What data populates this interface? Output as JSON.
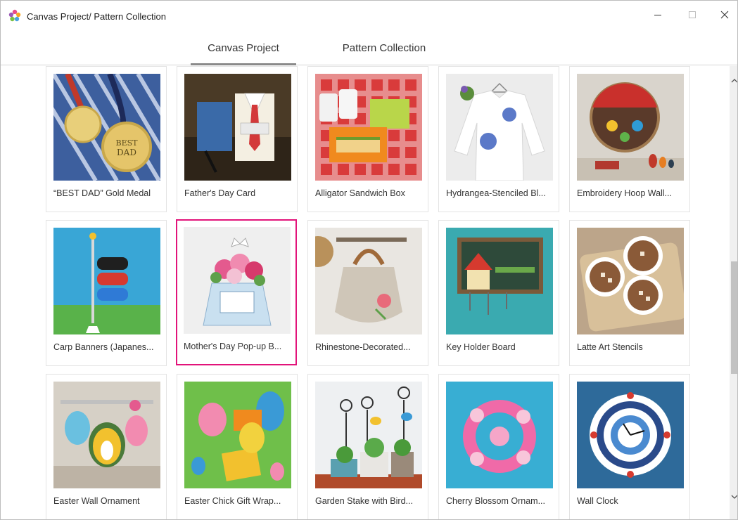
{
  "window": {
    "title": "Canvas Project/ Pattern Collection",
    "icon": "app-flower-icon",
    "controls": [
      "minimize-icon",
      "maximize-icon",
      "close-icon"
    ]
  },
  "tabs": [
    {
      "label": "Canvas Project",
      "active": true
    },
    {
      "label": "Pattern Collection",
      "active": false
    }
  ],
  "accent_color": "#e2137a",
  "projects": [
    {
      "title": "“BEST DAD” Gold Medal",
      "selected": false
    },
    {
      "title": "Father's Day Card",
      "selected": false
    },
    {
      "title": "Alligator Sandwich Box",
      "selected": false
    },
    {
      "title": "Hydrangea-Stenciled Bl...",
      "selected": false
    },
    {
      "title": "Embroidery Hoop Wall...",
      "selected": false
    },
    {
      "title": "Carp Banners (Japanes...",
      "selected": false
    },
    {
      "title": "Mother's Day Pop-up B...",
      "selected": true
    },
    {
      "title": "Rhinestone-Decorated...",
      "selected": false
    },
    {
      "title": "Key Holder Board",
      "selected": false
    },
    {
      "title": "Latte Art Stencils",
      "selected": false
    },
    {
      "title": "Easter Wall Ornament",
      "selected": false
    },
    {
      "title": "Easter Chick Gift Wrap...",
      "selected": false
    },
    {
      "title": "Garden Stake with Bird...",
      "selected": false
    },
    {
      "title": "Cherry Blossom Ornam...",
      "selected": false
    },
    {
      "title": "Wall Clock",
      "selected": false
    }
  ]
}
